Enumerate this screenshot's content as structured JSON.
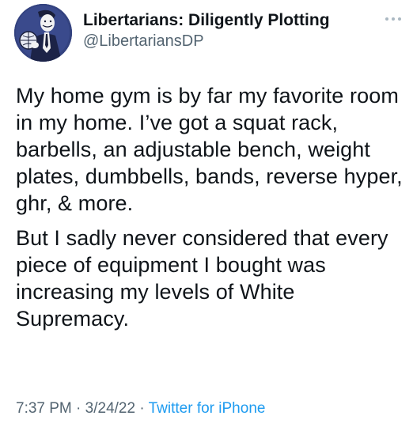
{
  "author": {
    "display_name": "Libertarians: Diligently Plotting",
    "handle": "@LibertariansDP"
  },
  "icons": {
    "avatar": "avatar-illustration",
    "more": "more-options-icon"
  },
  "tweet": {
    "paragraphs": [
      "My home gym is by far my favorite room in my home. I’ve got a squat rack, barbells, an adjustable bench, weight plates, dumbbells, bands, reverse hyper, ghr, & more.",
      "But I sadly never considered that every piece of equipment I bought was increasing my levels of White Supremacy."
    ]
  },
  "meta": {
    "time": "7:37 PM",
    "separator": " · ",
    "date": "3/24/22",
    "source": "Twitter for iPhone"
  },
  "colors": {
    "text": "#0f1419",
    "secondary": "#536471",
    "link": "#1d9bf0",
    "avatar_bg": "#2f3d7a"
  }
}
